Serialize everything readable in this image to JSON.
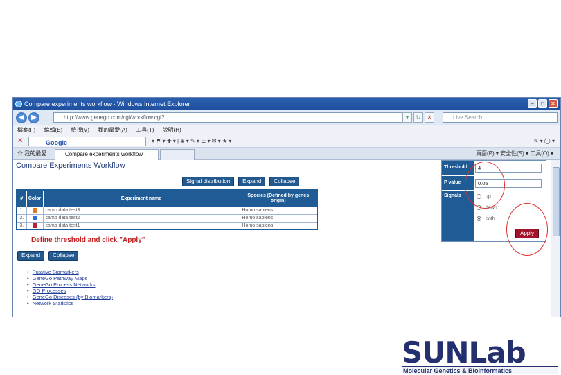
{
  "browser": {
    "window_title": "Compare experiments workflow - Windows Internet Explorer",
    "address": "http://www.genego.com/cgi/workflow.cgi?...",
    "live_search_placeholder": "Live Search",
    "menu": [
      "檔案(F)",
      "編輯(E)",
      "檢視(V)",
      "我的最愛(A)",
      "工具(T)",
      "說明(H)"
    ],
    "google_label": "Google",
    "favorites_label": "我的最愛",
    "tab_title": "Compare experiments workflow",
    "command_bar": "頁面(P) ▾  安全性(S) ▾  工具(O) ▾"
  },
  "page": {
    "title": "Compare Experiments Workflow",
    "buttons": {
      "signal_distribution": "Signal distribution",
      "expand": "Expand",
      "collapse": "Collapse"
    },
    "table": {
      "headers": [
        "#",
        "Color",
        "Experiment name",
        "Species (Defined by genes origin)"
      ],
      "rows": [
        {
          "num": "1.",
          "color": "#e07a1e",
          "name": "camo data test3",
          "species": "Homo sapiens"
        },
        {
          "num": "2.",
          "color": "#2c6fd1",
          "name": "camo data test2",
          "species": "Homo sapiens"
        },
        {
          "num": "3.",
          "color": "#c02030",
          "name": "camo data test1",
          "species": "Homo sapiens"
        }
      ]
    },
    "instruction": "Define threshold and click \"Apply\"",
    "lower_buttons": {
      "expand": "Expand",
      "collapse": "Collapse"
    },
    "links": [
      "Putative Biomarkers",
      "GeneGo Pathway Maps",
      "GeneGo Process Networks",
      "GO Processes",
      "GeneGo Diseases (by Biomarkers)",
      "Network Statistics"
    ]
  },
  "threshold_panel": {
    "threshold_label": "Threshold",
    "threshold_value": "4",
    "pvalue_label": "P value",
    "pvalue_value": "0.05",
    "signals_label": "Signals",
    "signal_options": [
      "up",
      "down",
      "both"
    ],
    "selected_signal": "both",
    "apply_label": "Apply"
  },
  "logo": {
    "name_part1": "SUN",
    "name_part2": "Lab",
    "tagline": "Molecular Genetics & Bioinformatics",
    "colors": {
      "primary": "#24306e",
      "accent": "#f0a020"
    }
  },
  "colors": {
    "table_header": "#1f5c95",
    "apply_button": "#a3132a",
    "annotation_circle": "#e03030"
  }
}
